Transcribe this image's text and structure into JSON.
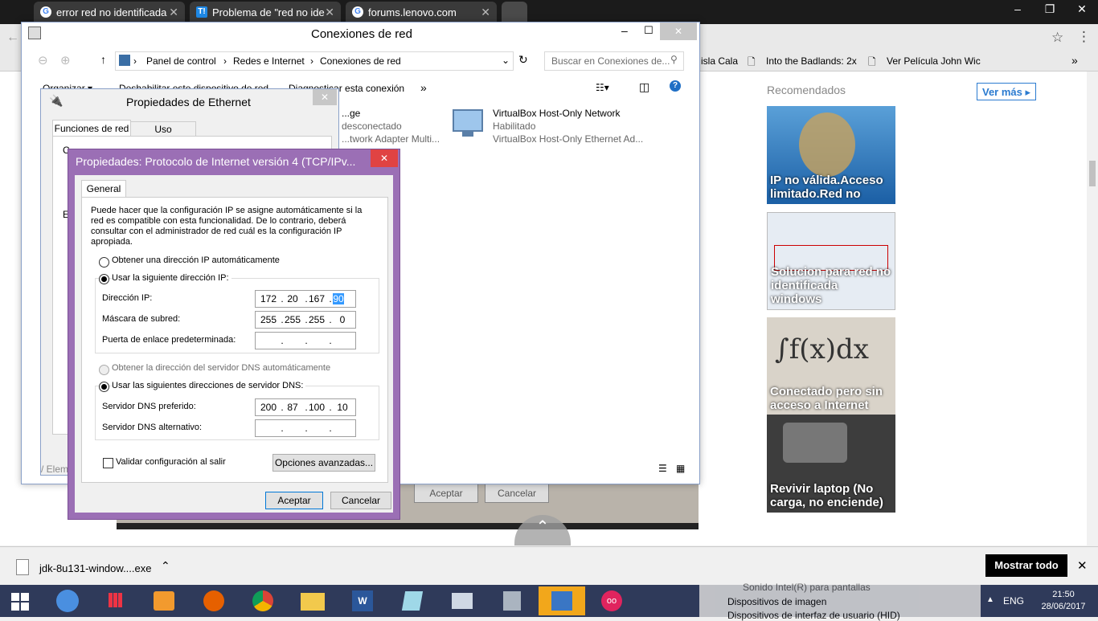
{
  "browser": {
    "tabs": [
      {
        "label": "error red no identificada",
        "icon": "G"
      },
      {
        "label": "Problema de \"red no ide",
        "icon": "T!"
      },
      {
        "label": "forums.lenovo.com",
        "icon": "G"
      }
    ],
    "bookmarks": [
      {
        "label": "isla Cala"
      },
      {
        "label": "Into the Badlands: 2x"
      },
      {
        "label": "Ver Película John Wic"
      }
    ],
    "more_bookmarks": "»"
  },
  "page": {
    "recommended_title": "Recomendados",
    "see_more": "Ver más",
    "cards": [
      {
        "caption": "IP no válida.Acceso limitado.Red no"
      },
      {
        "caption": "Solucion para red no identificada windows"
      },
      {
        "caption": "Conectado pero sin acceso a Internet"
      },
      {
        "caption": "Revivir laptop (No carga, no enciende)"
      }
    ],
    "bg_buttons": {
      "accept": "Aceptar",
      "cancel": "Cancelar"
    }
  },
  "explorer": {
    "title": "Conexiones de red",
    "breadcrumb": [
      "Panel de control",
      "Redes e Internet",
      "Conexiones de red"
    ],
    "search_placeholder": "Buscar en Conexiones de...",
    "commands": [
      "Organizar ▾",
      "Deshabilitar este dispositivo de red",
      "Diagnosticar esta conexión",
      "»"
    ],
    "items": [
      {
        "name": "...ge",
        "status": "desconectado",
        "device": "...twork Adapter Multi..."
      },
      {
        "name": "VirtualBox Host-Only Network",
        "status": "Habilitado",
        "device": "VirtualBox Host-Only Ethernet Ad..."
      }
    ]
  },
  "ethprops": {
    "title": "Propiedades de Ethernet",
    "tabs": [
      "Funciones de red",
      "Uso compartido"
    ],
    "labels": {
      "connect": "C",
      "elements": "E",
      "desc": "/ Elem"
    }
  },
  "ipv4": {
    "title": "Propiedades: Protocolo de Internet versión 4 (TCP/IPv...",
    "tab": "General",
    "intro": "Puede hacer que la configuración IP se asigne automáticamente si la red es compatible con esta funcionalidad. De lo contrario, deberá consultar con el administrador de red cuál es la configuración IP apropiada.",
    "opt_auto_ip": "Obtener una dirección IP automáticamente",
    "opt_manual_ip": "Usar la siguiente dirección IP:",
    "ip_label": "Dirección IP:",
    "ip": [
      "172",
      "20",
      "167",
      "90"
    ],
    "mask_label": "Máscara de subred:",
    "mask": [
      "255",
      "255",
      "255",
      "0"
    ],
    "gw_label": "Puerta de enlace predeterminada:",
    "gw": [
      "",
      "",
      "",
      ""
    ],
    "opt_auto_dns": "Obtener la dirección del servidor DNS automáticamente",
    "opt_manual_dns": "Usar las siguientes direcciones de servidor DNS:",
    "dns1_label": "Servidor DNS preferido:",
    "dns1": [
      "200",
      "87",
      "100",
      "10"
    ],
    "dns2_label": "Servidor DNS alternativo:",
    "dns2": [
      "",
      "",
      "",
      ""
    ],
    "validate": "Validar configuración al salir",
    "advanced": "Opciones avanzadas...",
    "ok": "Aceptar",
    "cancel": "Cancelar"
  },
  "download": {
    "file": "jdk-8u131-window....exe",
    "show_all": "Mostrar todo"
  },
  "taskbar": {
    "lang": "ENG",
    "time": "21:50",
    "date": "28/06/2017",
    "bg_devices": [
      "Sonido Intel(R) para pantallas",
      "Dispositivos de imagen",
      "Dispositivos de interfaz de usuario (HID)"
    ]
  }
}
